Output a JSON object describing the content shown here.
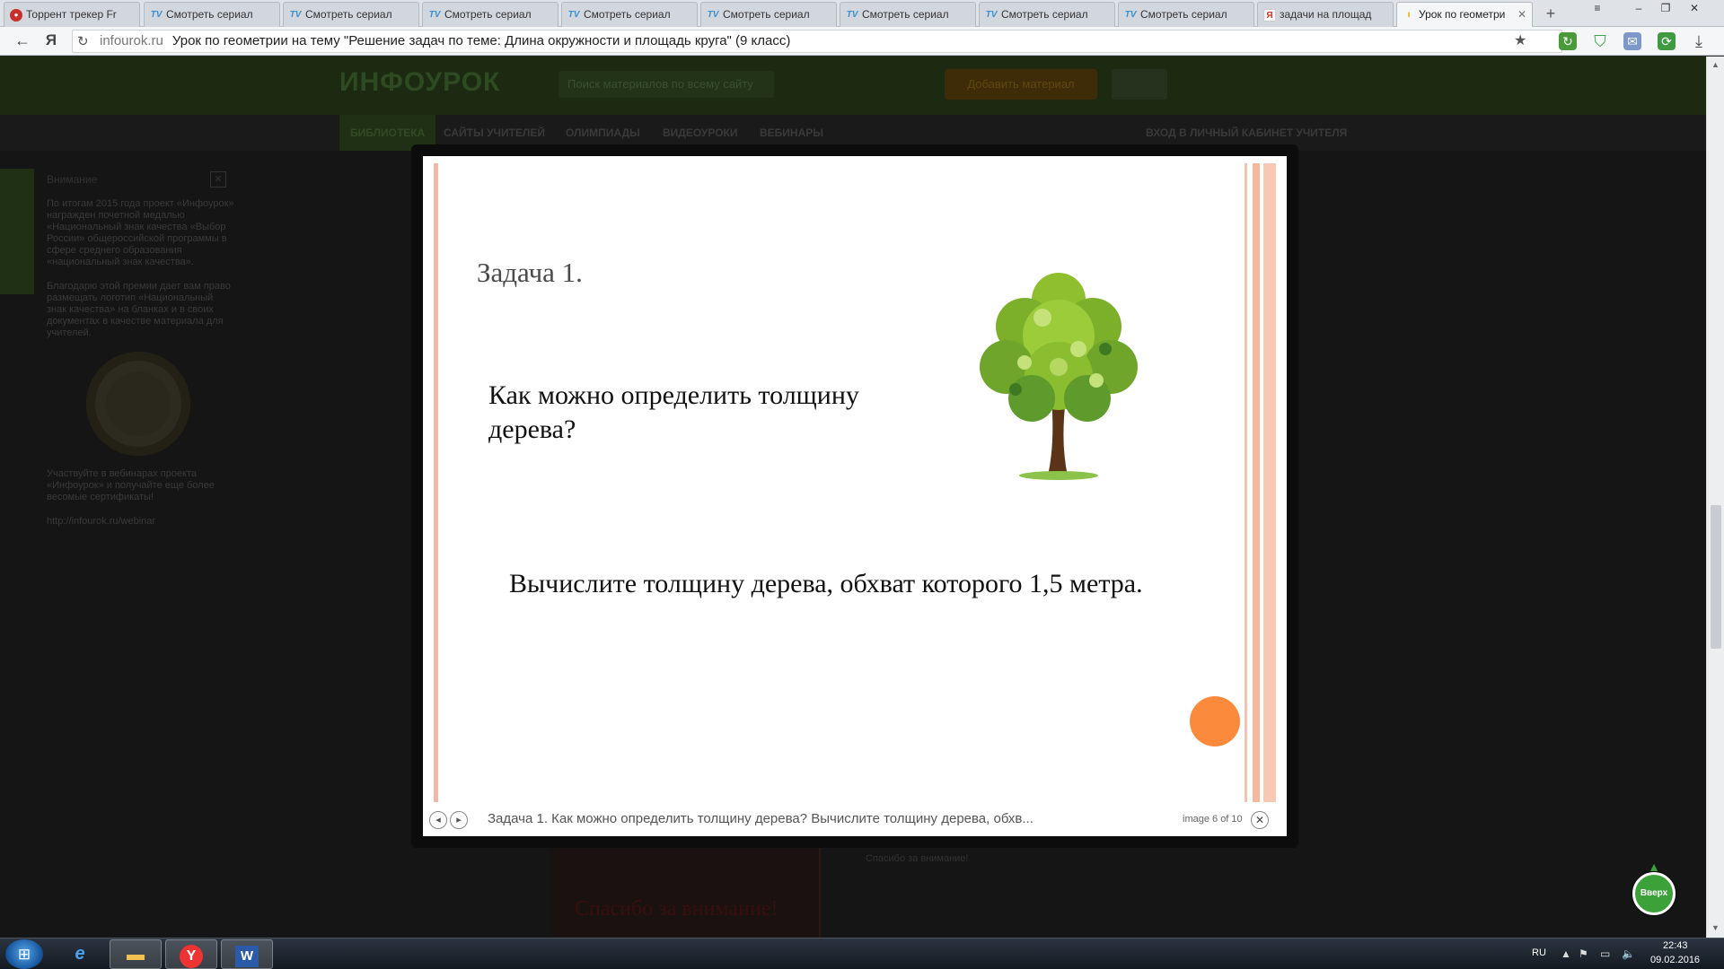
{
  "browser": {
    "tabs": [
      {
        "label": "Торрент трекер Fr",
        "icon": "torrent-icon",
        "active": false
      },
      {
        "label": "Смотреть сериал",
        "icon": "tv-icon",
        "active": false
      },
      {
        "label": "Смотреть сериал",
        "icon": "tv-icon",
        "active": false
      },
      {
        "label": "Смотреть сериал",
        "icon": "tv-icon",
        "active": false
      },
      {
        "label": "Смотреть сериал",
        "icon": "tv-icon",
        "active": false
      },
      {
        "label": "Смотреть сериал",
        "icon": "tv-icon",
        "active": false
      },
      {
        "label": "Смотреть сериал",
        "icon": "tv-icon",
        "active": false
      },
      {
        "label": "Смотреть сериал",
        "icon": "tv-icon",
        "active": false
      },
      {
        "label": "Смотреть сериал",
        "icon": "tv-icon",
        "active": false
      },
      {
        "label": "задачи на площад",
        "icon": "yandex-icon",
        "active": false
      },
      {
        "label": "Урок по геометри",
        "icon": "infourok-icon",
        "active": true
      }
    ],
    "address": {
      "domain": "infourok.ru",
      "title": "Урок по геометрии на тему \"Решение задач по теме: Длина окружности и площадь круга\" (9 класс)"
    }
  },
  "site": {
    "logo": "ИНФОУРОК",
    "search_placeholder": "Поиск материалов по всему сайту",
    "add_material": "Добавить материал",
    "nav": [
      "БИБЛИОТЕКА",
      "САЙТЫ УЧИТЕЛЕЙ",
      "ОЛИМПИАДЫ",
      "ВИДЕОУРОКИ",
      "ВЕБИНАРЫ"
    ],
    "cabinet": "ВХОД В ЛИЧНЫЙ КАБИНЕТ УЧИТЕЛЯ",
    "sidebar": {
      "heading": "Внимание",
      "text1": "По итогам 2015 года проект «Инфоурок» награжден почетной медалью «Национальный знак качества «Выбор России» общероссийской программы в сфере среднего образования «национальный знак качества».",
      "text2": "Благодарю этой премии дает вам право размещать логотип «Национальный знак качества» на бланках и в своих документах в качестве материала для учителей.",
      "text3": "Участвуйте в вебинарах проекта «Инфоурок» и получайте еще более весомые сертификаты!",
      "link": "http://infourok.ru/webinar"
    },
    "thanks_big": "Спасибо за внимание!",
    "thanks_small": "Спасибо за внимание!",
    "up_button": "Вверх"
  },
  "lightbox": {
    "slide": {
      "title": "Задача 1.",
      "question": "Как можно определить толщину дерева?",
      "task": "Вычислите толщину дерева, обхват которого 1,5 метра."
    },
    "caption": "Задача 1. Как можно определить толщину дерева? Вычислите толщину дерева, обхв...",
    "counter": "image 6 of 10",
    "colors": {
      "stripe": "#f5b6a4",
      "dot": "#fb8a3c"
    }
  },
  "taskbar": {
    "lang": "RU",
    "time": "22:43",
    "date": "09.02.2016"
  }
}
